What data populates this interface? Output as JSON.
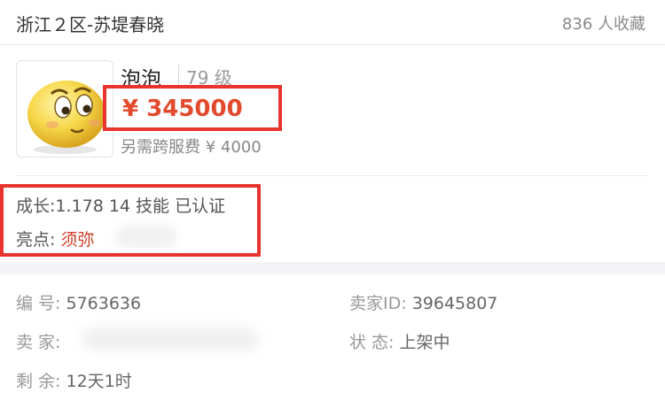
{
  "header": {
    "server": "浙江２区-苏堤春晓",
    "favorites": "836 人收藏"
  },
  "item": {
    "avatar_icon": "smiley-avatar",
    "name": "泡泡",
    "level": "79 级",
    "price": "¥ 345000",
    "transfer_fee": "另需跨服费 ¥ 4000"
  },
  "highlights": {
    "growth": "成长:1.178 14 技能 已认证",
    "label": "亮点: ",
    "value": "须弥"
  },
  "info": {
    "id_label": "编 号: ",
    "id_value": "5763636",
    "seller_id_label": "卖家ID: ",
    "seller_id_value": "39645807",
    "seller_label": "卖 家: ",
    "status_label": "状 态: ",
    "status_value": "上架中",
    "remain_label": "剩 余: ",
    "remain_value": "12天1时"
  },
  "colors": {
    "price": "#e24a2e",
    "highlight": "#d23c26",
    "annotation": "#e8332e"
  }
}
